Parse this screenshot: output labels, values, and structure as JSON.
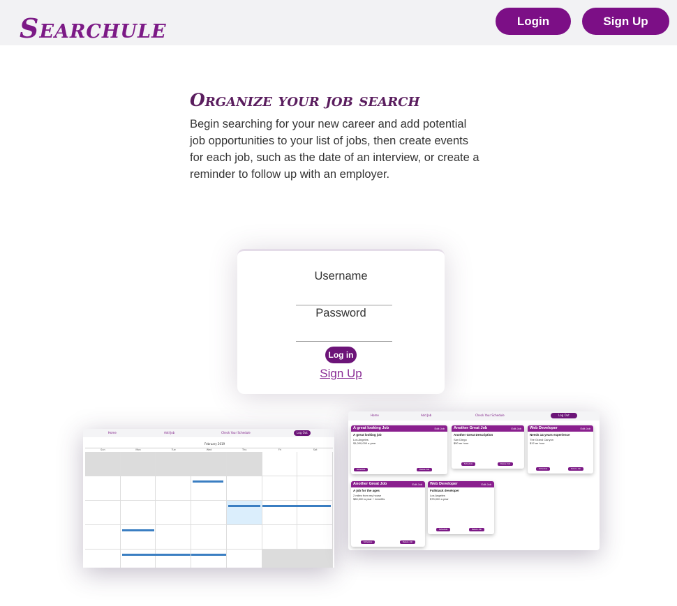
{
  "header": {
    "logo": "Searchule",
    "login_label": "Login",
    "signup_label": "Sign Up"
  },
  "intro": {
    "title": "Organize your job search",
    "body": "Begin searching for your new career and add potential job opportunities to your list of jobs, then create events for each job, such as the date of an interview, or create a reminder to follow up with an employer."
  },
  "login_form": {
    "username_label": "Username",
    "password_label": "Password",
    "submit_label": "Log in",
    "signup_link": "Sign Up"
  },
  "calendar_preview": {
    "nav": [
      "Home",
      "Add Job",
      "Check Your Schedule"
    ],
    "logout": "Log Out",
    "month": "February 2019",
    "days": [
      "Sun",
      "Mon",
      "Tue",
      "Wed",
      "Thu",
      "Fri",
      "Sat"
    ]
  },
  "jobs_preview": {
    "nav": [
      "Home",
      "Add Job",
      "Check Your Schedule"
    ],
    "logout": "Log Out",
    "cards": [
      {
        "title": "A great looking Job",
        "desc": "A great looking job",
        "location": "Los Angeles",
        "pay": "$1,000,000 a year"
      },
      {
        "title": "Another Great Job",
        "desc": "Another Great Description",
        "location": "San Diego",
        "pay": "$50 an hour"
      },
      {
        "title": "Web Developer",
        "desc": "Needs 14 years experience",
        "location": "The Grand Canyon",
        "pay": "$12 an hour"
      },
      {
        "title": "Another Great Job",
        "desc": "A job for the ages",
        "location": "2 miles from my house",
        "pay": "$80,000 a year + benefits"
      },
      {
        "title": "Web Developer",
        "desc": "Fullstack developer",
        "location": "Los Angeles",
        "pay": "$75,000 a year"
      }
    ],
    "edit": "Edit Job",
    "schedule": "Schedule",
    "delete": "Delete Job"
  },
  "colors": {
    "brand": "#7c0f86",
    "topbar": "#f2f2f4"
  }
}
